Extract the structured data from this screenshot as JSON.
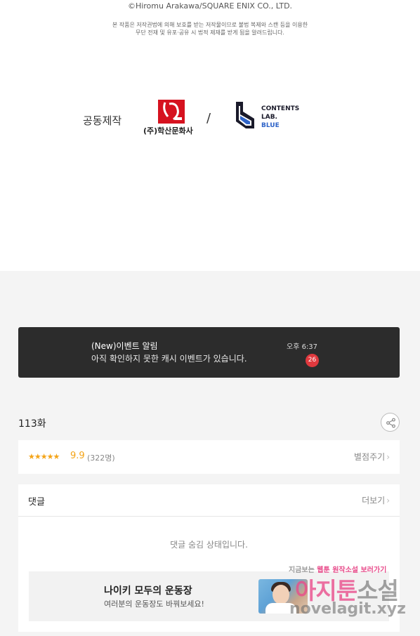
{
  "credits": {
    "copyright": "©Hiromu Arakawa/SQUARE ENIX CO., LTD.",
    "notice_line1": "본 작품은 저작권법에 의해 보호를 받는 저작물이므로 불법 복제와 스캔 등을 이용한",
    "notice_line2": "무단 전재 및 유포·공유 시 법적 제재를 받게 됨을 알려드립니다.",
    "coproduction_label": "공동제작",
    "partner1_name": "(주)학산문화사",
    "separator": "/",
    "partner2_line1": "CONTENTS",
    "partner2_line2": "LAB.",
    "partner2_line3": "BLUE"
  },
  "notification": {
    "title": "(New)이벤트 알림",
    "message": "아직 확인하지 못한 캐시 이벤트가 있습니다.",
    "time": "오후 6:37",
    "badge_count": "26"
  },
  "episode": {
    "title": "113화",
    "share_icon": "share-icon"
  },
  "rating": {
    "stars": "★★★★★",
    "score": "9.9",
    "count": "(322명)",
    "rate_button": "별점주기"
  },
  "comments": {
    "header": "댓글",
    "more_label": "더보기",
    "hidden_message": "댓글 숨김 상태입니다."
  },
  "promo_banner": {
    "title": "나이키 모두의 운동장",
    "subtitle": "여러분의 운동장도 바꿔보세요!"
  },
  "watermark": {
    "tagline_a": "지금보는",
    "tagline_b": "웹툰",
    "tagline_c": "원작소설",
    "tagline_d": "보러가기",
    "brand_a": "아지툰",
    "brand_b": "소설",
    "url": "novelagit.xyz"
  },
  "colors": {
    "rating_accent": "#f4a417",
    "badge": "#e0393e",
    "toast_bg": "#2c2c2c",
    "publisher_red": "#d6121f",
    "lab_blue": "#2f64c8"
  }
}
